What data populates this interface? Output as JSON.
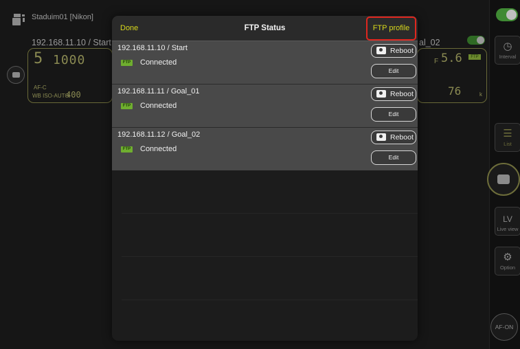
{
  "background_app": {
    "title": "Staduim01 [Nikon]",
    "camera_left_label": "192.168.11.10 / Start",
    "camera_right_label_partial": "al_02",
    "left_lcd": {
      "shutter": "5",
      "seg_value": "1000",
      "af_mode": "AF-C",
      "iso_text": "WB ISO-AUTO",
      "iso_value": "400"
    },
    "right_lcd": {
      "aperture_prefix": "F",
      "aperture": "5.6",
      "frames": "76",
      "frames_suffix": "k",
      "ftp_icon": "FTP"
    }
  },
  "sidebar": {
    "toggle_on": true,
    "interval_label": "Interval",
    "list_label": "List",
    "live_view_title": "LV",
    "live_view_label": "Live view",
    "option_label": "Option",
    "af_on_label": "AF-ON"
  },
  "modal": {
    "done_label": "Done",
    "title": "FTP Status",
    "ftp_profile_label": "FTP profile",
    "rows": [
      {
        "ip": "192.168.11.10 / Start",
        "badge": "FTP",
        "status": "Connected",
        "reboot_label": "Reboot",
        "edit_label": "Edit"
      },
      {
        "ip": "192.168.11.11 / Goal_01",
        "badge": "FTP",
        "status": "Connected",
        "reboot_label": "Reboot",
        "edit_label": "Edit"
      },
      {
        "ip": "192.168.11.12 / Goal_02",
        "badge": "FTP",
        "status": "Connected",
        "reboot_label": "Reboot",
        "edit_label": "Edit"
      }
    ]
  },
  "colors": {
    "accent_yellow": "#d8d81c",
    "highlight_red": "#e0271f",
    "ftp_green": "#6fae2f",
    "toggle_green": "#3f8a33"
  }
}
